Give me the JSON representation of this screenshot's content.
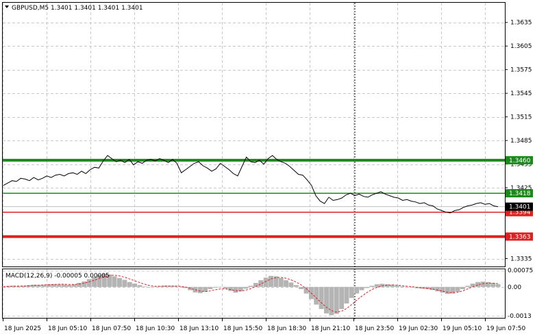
{
  "header": {
    "symbol_line": "GBPUSD,M5  1.3401 1.3401 1.3401 1.3401",
    "menu_icon": "triangle-down-icon"
  },
  "macd": {
    "label": "MACD(12,26,9) -0.00005 0.00005",
    "ticks": [
      "0.00075",
      "0.00",
      "-0.0013"
    ]
  },
  "levels": [
    {
      "label": "1.3460",
      "value": 1.346,
      "color": "#1a8a1a",
      "weight": "thick"
    },
    {
      "label": "1.3418",
      "value": 1.3418,
      "color": "#1a8a1a",
      "weight": "thin"
    },
    {
      "label": "1.3394",
      "value": 1.3394,
      "color": "#e02020",
      "weight": "thin"
    },
    {
      "label": "1.3363",
      "value": 1.3363,
      "color": "#e02020",
      "weight": "thick"
    }
  ],
  "current_price": {
    "label": "1.3401",
    "value": 1.3401
  },
  "colors": {
    "grid": "#c8c8c8",
    "price_line": "#000000",
    "support": "#e02020",
    "resistance": "#1a8a1a",
    "macd_hist": "#b4b4b4",
    "macd_signal": "#e02020"
  },
  "chart_data": {
    "type": "line",
    "title": "GBPUSD,M5",
    "ylim": [
      1.3325,
      1.366
    ],
    "yticks": [
      "1.3635",
      "1.3605",
      "1.3575",
      "1.3545",
      "1.3515",
      "1.3485",
      "1.3455",
      "1.3425",
      "1.3335"
    ],
    "ytick_values": [
      1.3635,
      1.3605,
      1.3575,
      1.3545,
      1.3515,
      1.3485,
      1.3455,
      1.3425,
      1.3335
    ],
    "xticks": [
      "18 Jun 2025",
      "18 Jun 05:10",
      "18 Jun 07:50",
      "18 Jun 10:30",
      "18 Jun 13:10",
      "18 Jun 15:50",
      "18 Jun 18:30",
      "18 Jun 21:10",
      "18 Jun 23:50",
      "19 Jun 02:30",
      "19 Jun 05:10",
      "19 Jun 07:50"
    ],
    "series": [
      {
        "values": [
          1.3428,
          1.3431,
          1.3434,
          1.3433,
          1.3437,
          1.3436,
          1.3434,
          1.3438,
          1.3435,
          1.3437,
          1.344,
          1.3438,
          1.3441,
          1.3442,
          1.344,
          1.3443,
          1.3444,
          1.3442,
          1.3446,
          1.3443,
          1.3448,
          1.3451,
          1.345,
          1.3459,
          1.3466,
          1.3462,
          1.3458,
          1.346,
          1.3457,
          1.3461,
          1.3454,
          1.3458,
          1.3456,
          1.346,
          1.3461,
          1.3459,
          1.3462,
          1.346,
          1.3457,
          1.3461,
          1.3456,
          1.3444,
          1.3448,
          1.3452,
          1.3456,
          1.3458,
          1.3453,
          1.345,
          1.3446,
          1.3449,
          1.3456,
          1.3452,
          1.3448,
          1.3443,
          1.344,
          1.3452,
          1.3464,
          1.3458,
          1.3457,
          1.346,
          1.3455,
          1.3462,
          1.3466,
          1.3461,
          1.3458,
          1.3456,
          1.3452,
          1.3447,
          1.3442,
          1.3441,
          1.3435,
          1.3428,
          1.3415,
          1.3408,
          1.3405,
          1.3413,
          1.3409,
          1.341,
          1.3412,
          1.3416,
          1.3418,
          1.3415,
          1.3417,
          1.3414,
          1.3413,
          1.3416,
          1.3418,
          1.342,
          1.3417,
          1.3415,
          1.3413,
          1.3412,
          1.3409,
          1.341,
          1.3408,
          1.3407,
          1.3405,
          1.3406,
          1.3403,
          1.3402,
          1.3398,
          1.3396,
          1.3394,
          1.3393,
          1.3396,
          1.3397,
          1.34,
          1.3402,
          1.3403,
          1.3405,
          1.3406,
          1.3404,
          1.3405,
          1.3402,
          1.3401
        ]
      }
    ],
    "macd_ylim": [
      -0.0014,
      0.0008
    ],
    "macd_histogram": [
      2e-05,
      5e-05,
      6e-05,
      3e-05,
      5e-05,
      8e-05,
      0.0001,
      9e-05,
      0.0001,
      0.00012,
      0.00013,
      0.00012,
      0.00011,
      9e-05,
      0.00012,
      0.00018,
      0.00025,
      0.00035,
      0.00045,
      0.00055,
      0.0006,
      0.00056,
      0.00048,
      0.0004,
      0.00032,
      0.00022,
      0.00015,
      8e-05,
      2e-05,
      -2e-05,
      1e-05,
      4e-05,
      6e-05,
      5e-05,
      4e-05,
      2e-05,
      -5e-05,
      -0.00015,
      -0.00025,
      -0.00028,
      -0.00022,
      -0.0001,
      -3e-05,
      0.0,
      -8e-05,
      -0.00018,
      -0.00026,
      -0.0002,
      -8e-05,
      5e-05,
      0.00018,
      0.0003,
      0.00042,
      0.0005,
      0.00048,
      0.0004,
      0.0003,
      0.0002,
      8e-05,
      -0.0001,
      -0.0003,
      -0.00055,
      -0.0008,
      -0.001,
      -0.0012,
      -0.00128,
      -0.00122,
      -0.001,
      -0.00075,
      -0.0005,
      -0.0003,
      -0.00015,
      -5e-05,
      5e-05,
      0.00012,
      0.00014,
      0.00012,
      0.0001,
      6e-05,
      3e-05,
      0.0,
      -2e-05,
      -6e-05,
      -8e-05,
      -0.0001,
      -0.00014,
      -0.0002,
      -0.00026,
      -0.00032,
      -0.0003,
      -0.00022,
      -0.0001,
      5e-05,
      0.00015,
      0.00022,
      0.00024,
      0.00022,
      0.00018,
      0.00012
    ],
    "macd_signal": [
      0.0,
      2e-05,
      3e-05,
      4e-05,
      4e-05,
      5e-05,
      7e-05,
      8e-05,
      9e-05,
      0.0001,
      0.00011,
      0.00012,
      0.00012,
      0.00011,
      0.00011,
      0.00013,
      0.00017,
      0.00023,
      0.0003,
      0.00038,
      0.00046,
      0.00052,
      0.00053,
      0.0005,
      0.00044,
      0.00036,
      0.00028,
      0.0002,
      0.00012,
      6e-05,
      3e-05,
      3e-05,
      4e-05,
      4e-05,
      4e-05,
      3e-05,
      0.0,
      -6e-05,
      -0.00013,
      -0.00019,
      -0.00021,
      -0.00018,
      -0.00013,
      -9e-05,
      -9e-05,
      -0.00012,
      -0.00017,
      -0.00018,
      -0.00015,
      -8e-05,
      2e-05,
      0.00013,
      0.00025,
      0.00036,
      0.00042,
      0.00043,
      0.00039,
      0.00032,
      0.00022,
      9e-05,
      -8e-05,
      -0.00028,
      -0.0005,
      -0.00072,
      -0.00092,
      -0.00107,
      -0.00114,
      -0.0011,
      -0.00098,
      -0.0008,
      -0.0006,
      -0.00042,
      -0.00026,
      -0.00012,
      -2e-05,
      5e-05,
      8e-05,
      9e-05,
      8e-05,
      6e-05,
      3e-05,
      1e-05,
      -2e-05,
      -4e-05,
      -7e-05,
      -0.0001,
      -0.00014,
      -0.00019,
      -0.00024,
      -0.00026,
      -0.00024,
      -0.00018,
      -9e-05,
      1e-05,
      9e-05,
      0.00015,
      0.00017,
      0.00017,
      0.00015
    ]
  }
}
